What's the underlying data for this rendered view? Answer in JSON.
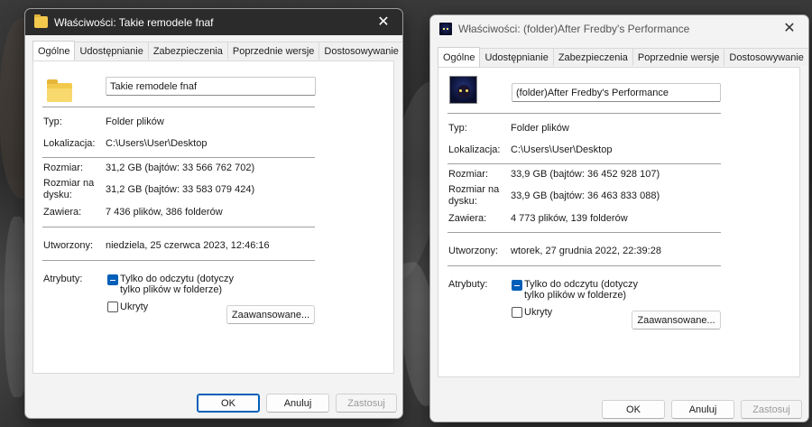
{
  "window1": {
    "title": "Właściwości: Takie remodele fnaf",
    "close_glyph": "✕",
    "tabs": [
      "Ogólne",
      "Udostępnianie",
      "Zabezpieczenia",
      "Poprzednie wersje",
      "Dostosowywanie"
    ],
    "name_value": "Takie remodele fnaf",
    "labels": {
      "type": "Typ:",
      "location": "Lokalizacja:",
      "size": "Rozmiar:",
      "size_on_disk": "Rozmiar na dysku:",
      "contains": "Zawiera:",
      "created": "Utworzony:",
      "attributes": "Atrybuty:"
    },
    "values": {
      "type": "Folder plików",
      "location": "C:\\Users\\User\\Desktop",
      "size": "31,2 GB (bajtów: 33 566 762 702)",
      "size_on_disk": "31,2 GB (bajtów: 33 583 079 424)",
      "contains": "7 436 plików, 386 folderów",
      "created": "niedziela, 25 czerwca 2023, 12:46:16"
    },
    "readonly_label": "Tylko do odczytu (dotyczy tylko plików w folderze)",
    "hidden_label": "Ukryty",
    "advanced_button": "Zaawansowane...",
    "ok_button": "OK",
    "cancel_button": "Anuluj",
    "apply_button": "Zastosuj"
  },
  "window2": {
    "title": "Właściwości: (folder)After Fredby's Performance",
    "close_glyph": "✕",
    "tabs": [
      "Ogólne",
      "Udostępnianie",
      "Zabezpieczenia",
      "Poprzednie wersje",
      "Dostosowywanie"
    ],
    "name_value": "(folder)After Fredby's Performance",
    "labels": {
      "type": "Typ:",
      "location": "Lokalizacja:",
      "size": "Rozmiar:",
      "size_on_disk": "Rozmiar na dysku:",
      "contains": "Zawiera:",
      "created": "Utworzony:",
      "attributes": "Atrybuty:"
    },
    "values": {
      "type": "Folder plików",
      "location": "C:\\Users\\User\\Desktop",
      "size": "33,9 GB (bajtów: 36 452 928 107)",
      "size_on_disk": "33,9 GB (bajtów: 36 463 833 088)",
      "contains": "4 773 plików, 139 folderów",
      "created": "wtorek, 27 grudnia 2022, 22:39:28"
    },
    "readonly_label": "Tylko do odczytu (dotyczy tylko plików w folderze)",
    "hidden_label": "Ukryty",
    "advanced_button": "Zaawansowane...",
    "ok_button": "OK",
    "cancel_button": "Anuluj",
    "apply_button": "Zastosuj"
  },
  "icons": {
    "window1_title_icon": "folder-icon",
    "window1_large_icon": "folder-icon",
    "window2_title_icon": "folder-thumbnail-icon",
    "window2_large_icon": "folder-thumbnail-icon",
    "readonly_checkbox_state": "indeterminate",
    "hidden_checkbox_state": "unchecked"
  },
  "colors": {
    "accent": "#005fb8",
    "folder": "#f2c94c",
    "active_titlebar": "#2b2b2b"
  }
}
